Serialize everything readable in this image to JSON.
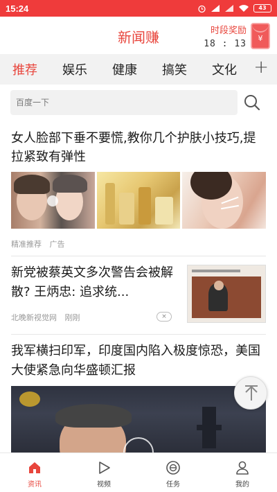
{
  "status_bar": {
    "time": "15:24",
    "battery": "43"
  },
  "header": {
    "title": "新闻赚",
    "reward_label": "时段奖励",
    "reward_timer": "18 : 13",
    "envelope_symbol": "¥"
  },
  "tabs": [
    {
      "label": "推荐",
      "active": true
    },
    {
      "label": "娱乐",
      "active": false
    },
    {
      "label": "健康",
      "active": false
    },
    {
      "label": "搞笑",
      "active": false
    },
    {
      "label": "文化",
      "active": false
    }
  ],
  "tabs_more_symbol": "+",
  "search": {
    "placeholder": "百度一下"
  },
  "articles": [
    {
      "headline": "女人脸部下垂不要慌,教你几个护肤小技巧,提拉紧致有弹性",
      "tag": "精准推荐",
      "type": "广告"
    },
    {
      "headline": "新党被蔡英文多次警告会被解散? 王炳忠: 追求统...",
      "source": "北晚新视觉网",
      "time": "刚刚",
      "dismiss": "×"
    },
    {
      "headline": "我军横扫印军，印度国内陷入极度惊恐，美国大使紧急向华盛顿汇报"
    }
  ],
  "bottom_nav": [
    {
      "label": "资讯",
      "icon": "home-icon",
      "active": true
    },
    {
      "label": "视频",
      "icon": "play-icon",
      "active": false
    },
    {
      "label": "任务",
      "icon": "task-icon",
      "active": false
    },
    {
      "label": "我的",
      "icon": "user-icon",
      "active": false
    }
  ],
  "colors": {
    "accent": "#e8453c",
    "status_bar": "#ef3b3b",
    "tab_bar_bg": "#f2f2f2"
  }
}
